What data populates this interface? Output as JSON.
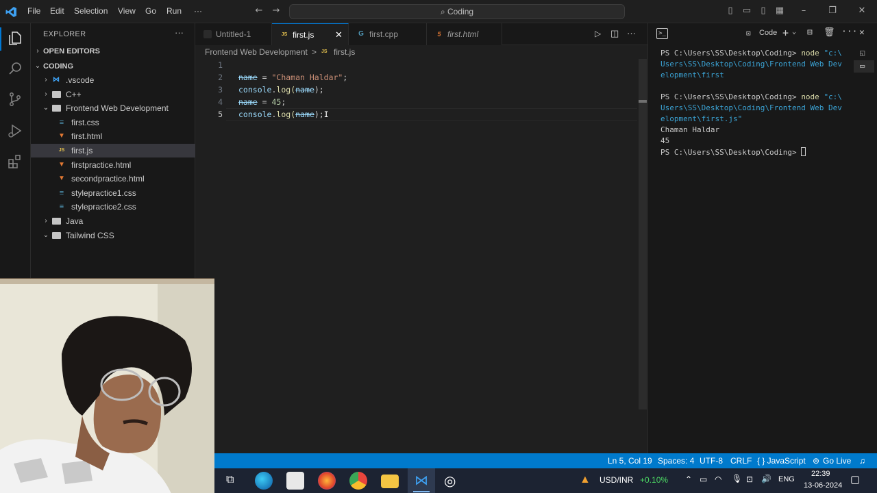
{
  "titlebar": {
    "menu": [
      "File",
      "Edit",
      "Selection",
      "View",
      "Go",
      "Run",
      "···"
    ],
    "search": "Coding"
  },
  "sidebar": {
    "title": "EXPLORER",
    "more": "···",
    "open_editors": "OPEN EDITORS",
    "workspace": "CODING",
    "items": [
      {
        "label": ".vscode",
        "type": "folder-special"
      },
      {
        "label": "C++",
        "type": "folder"
      },
      {
        "label": "Frontend Web Development",
        "type": "folder-open"
      },
      {
        "label": "first.css",
        "type": "css"
      },
      {
        "label": "first.html",
        "type": "html"
      },
      {
        "label": "first.js",
        "type": "js"
      },
      {
        "label": "firstpractice.html",
        "type": "html"
      },
      {
        "label": "secondpractice.html",
        "type": "html"
      },
      {
        "label": "stylepractice1.css",
        "type": "css"
      },
      {
        "label": "stylepractice2.css",
        "type": "css"
      },
      {
        "label": "Java",
        "type": "folder"
      },
      {
        "label": "Tailwind CSS",
        "type": "folder-open"
      }
    ]
  },
  "tabs": [
    {
      "label": "Untitled-1",
      "icon": "JS"
    },
    {
      "label": "first.js",
      "icon": "JS"
    },
    {
      "label": "first.cpp",
      "icon": "G"
    },
    {
      "label": "first.html",
      "icon": "5"
    }
  ],
  "breadcrumb": {
    "folder": "Frontend Web Development",
    "sep": ">",
    "file": "first.js"
  },
  "editor": {
    "line_numbers": [
      "1",
      "2",
      "3",
      "4",
      "5"
    ],
    "line2": {
      "var": "name",
      "op": " = ",
      "str": "\"Chaman Haldar\"",
      "end": ";"
    },
    "line3": {
      "obj": "console",
      "dot": ".",
      "fn": "log",
      "open": "(",
      "var": "name",
      "close": ");"
    },
    "line4": {
      "var": "name",
      "op": " = ",
      "num": "45",
      "end": ";"
    },
    "line5": {
      "obj": "console",
      "dot": ".",
      "fn": "log",
      "open": "(",
      "var": "name",
      "close": ");"
    }
  },
  "terminal": {
    "panel_label": "Code",
    "lines": [
      {
        "ps": "PS C:\\Users\\SS\\Desktop\\Coding> ",
        "cmd": "node ",
        "path": "\"c:\\"
      },
      {
        "path": "Users\\SS\\Desktop\\Coding\\Frontend Web Dev"
      },
      {
        "path": "elopment\\first"
      },
      {
        "ps": "PS C:\\Users\\SS\\Desktop\\Coding> ",
        "cmd": "node ",
        "path": "\"c:\\"
      },
      {
        "path": "Users\\SS\\Desktop\\Coding\\Frontend Web Dev"
      },
      {
        "path": "elopment\\first.js\""
      },
      {
        "out": "Chaman Haldar"
      },
      {
        "out": "45"
      },
      {
        "ps": "PS C:\\Users\\SS\\Desktop\\Coding> "
      }
    ]
  },
  "statusbar": {
    "position": "Ln 5, Col 19",
    "spaces": "Spaces: 4",
    "encoding": "UTF-8",
    "eol": "CRLF",
    "language": "{ } JavaScript",
    "golive": "Go Live"
  },
  "taskbar": {
    "ticker": "USD/INR",
    "change": "+0.10%",
    "lang": "ENG",
    "time": "22:39",
    "date": "13-06-2024"
  },
  "colors": {
    "accent": "#007acc",
    "js": "#e8c44f",
    "html": "#e37933",
    "css": "#519aba"
  }
}
